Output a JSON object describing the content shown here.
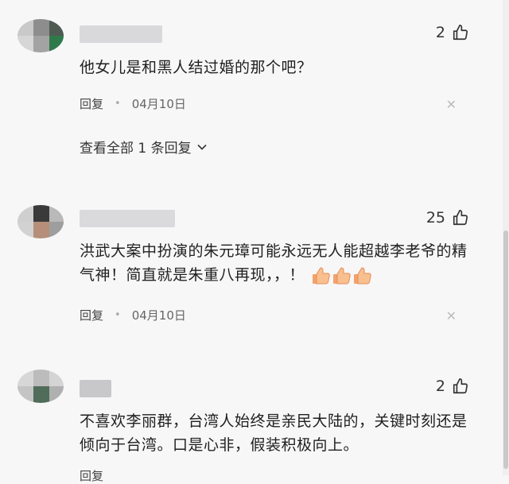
{
  "comments": [
    {
      "likes": "2",
      "text": "他女儿是和黑人结过婚的那个吧？",
      "reply_label": "回复",
      "date": "04月10日",
      "view_replies": "查看全部 1 条回复"
    },
    {
      "likes": "25",
      "text": "洪武大案中扮演的朱元璋可能永远无人能超越李老爷的精气神！简直就是朱重八再现，，！",
      "reply_label": "回复",
      "date": "04月10日"
    },
    {
      "likes": "2",
      "text": "不喜欢李丽群，台湾人始终是亲民大陆的，关键时刻还是倾向于台湾。口是心非，假装积极向上。",
      "reply_label": "回复"
    }
  ],
  "icons": {
    "like": "thumbs-up-outline-icon",
    "close": "close-icon",
    "chevron": "chevron-down-icon",
    "emoji": "thumbs-up-emoji"
  }
}
